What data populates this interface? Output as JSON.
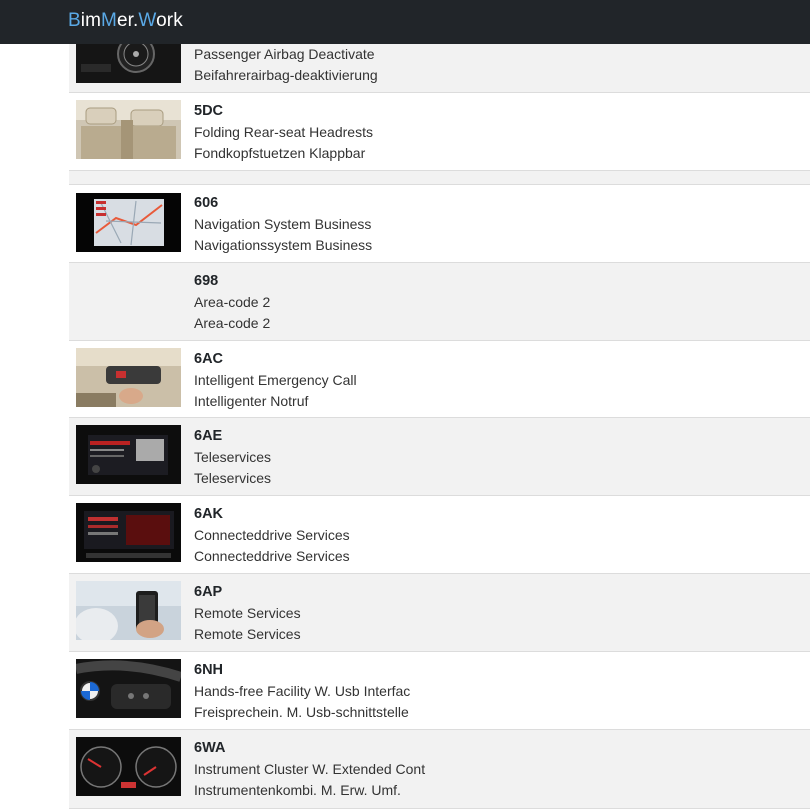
{
  "nav": {
    "brand_b": "B",
    "brand_im": "im",
    "brand_m": "M",
    "brand_er": "er.",
    "brand_w": "W",
    "brand_ork": "ork"
  },
  "items": [
    {
      "code": "",
      "en": "Passenger Airbag Deactivate",
      "de": "Beifahrerairbag-deaktivierung",
      "thumb": "dash-dial-photo"
    },
    {
      "code": "5DC",
      "en": "Folding Rear-seat Headrests",
      "de": "Fondkopfstuetzen Klappbar",
      "thumb": "rear-seat-headrest-photo"
    },
    {
      "code": "606",
      "en": "Navigation System Business",
      "de": "Navigationssystem Business",
      "thumb": "navigation-map-screen"
    },
    {
      "code": "698",
      "en": "Area-code 2",
      "de": "Area-code 2",
      "thumb": ""
    },
    {
      "code": "6AC",
      "en": "Intelligent Emergency Call",
      "de": "Intelligenter Notruf",
      "thumb": "overhead-sos-button-photo"
    },
    {
      "code": "6AE",
      "en": "Teleservices",
      "de": "Teleservices",
      "thumb": "idrive-teleservices-screen"
    },
    {
      "code": "6AK",
      "en": "Connecteddrive Services",
      "de": "Connecteddrive Services",
      "thumb": "idrive-connecteddrive-screen"
    },
    {
      "code": "6AP",
      "en": "Remote Services",
      "de": "Remote Services",
      "thumb": "smartphone-remote-photo"
    },
    {
      "code": "6NH",
      "en": "Hands-free Facility W. Usb Interfac",
      "de": "Freisprechein. M. Usb-schnittstelle",
      "thumb": "steering-wheel-photo"
    },
    {
      "code": "6WA",
      "en": "Instrument Cluster W. Extended Cont",
      "de": "Instrumentenkombi. M. Erw. Umf.",
      "thumb": "instrument-cluster-photo"
    }
  ]
}
